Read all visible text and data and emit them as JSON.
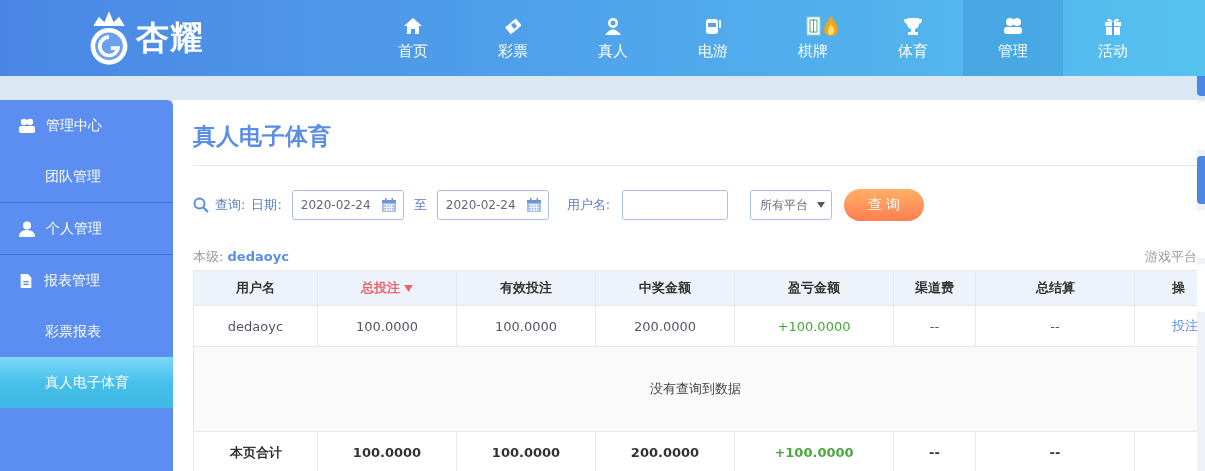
{
  "logo": {
    "text": "杏耀"
  },
  "nav": [
    {
      "label": "首页",
      "selected": false,
      "hot": false
    },
    {
      "label": "彩票",
      "selected": false,
      "hot": false
    },
    {
      "label": "真人",
      "selected": false,
      "hot": false
    },
    {
      "label": "电游",
      "selected": false,
      "hot": false
    },
    {
      "label": "棋牌",
      "selected": false,
      "hot": true
    },
    {
      "label": "体育",
      "selected": false,
      "hot": false
    },
    {
      "label": "管理",
      "selected": true,
      "hot": false
    },
    {
      "label": "活动",
      "selected": false,
      "hot": false
    }
  ],
  "sidebar": [
    {
      "title": "管理中心",
      "children": [
        {
          "label": "团队管理",
          "selected": false
        }
      ]
    },
    {
      "title": "个人管理"
    },
    {
      "title": "报表管理",
      "children": [
        {
          "label": "彩票报表",
          "selected": false
        },
        {
          "label": "真人电子体育",
          "selected": true
        }
      ]
    }
  ],
  "page_title": "真人电子体育",
  "filter": {
    "search_label": "查询:",
    "date_label": "日期:",
    "date_from": "2020-02-24",
    "to_label": "至",
    "date_to": "2020-02-24",
    "username_label": "用户名:",
    "platform": "所有平台",
    "submit": "查 询"
  },
  "level": {
    "label": "本级:",
    "user": "dedaoyc"
  },
  "platform_note": "游戏平台",
  "table": {
    "columns": [
      {
        "label": "用户名",
        "kind": "text",
        "sorted": false
      },
      {
        "label": "总投注",
        "kind": "money",
        "sorted": true
      },
      {
        "label": "有效投注",
        "kind": "money",
        "sorted": false
      },
      {
        "label": "中奖金额",
        "kind": "money",
        "sorted": false
      },
      {
        "label": "盈亏金额",
        "kind": "profit",
        "sorted": false
      },
      {
        "label": "渠道费",
        "kind": "text",
        "sorted": false
      },
      {
        "label": "总结算",
        "kind": "text",
        "sorted": false
      },
      {
        "label": "操",
        "kind": "action",
        "sorted": false
      }
    ],
    "rows": [
      [
        "dedaoyc",
        "100.0000",
        "100.0000",
        "200.0000",
        "+100.0000",
        "--",
        "--",
        "投注"
      ]
    ],
    "empty_message": "没有查询到数据",
    "totals": [
      "本页合计",
      "100.0000",
      "100.0000",
      "200.0000",
      "+100.0000",
      "--",
      "--"
    ]
  }
}
